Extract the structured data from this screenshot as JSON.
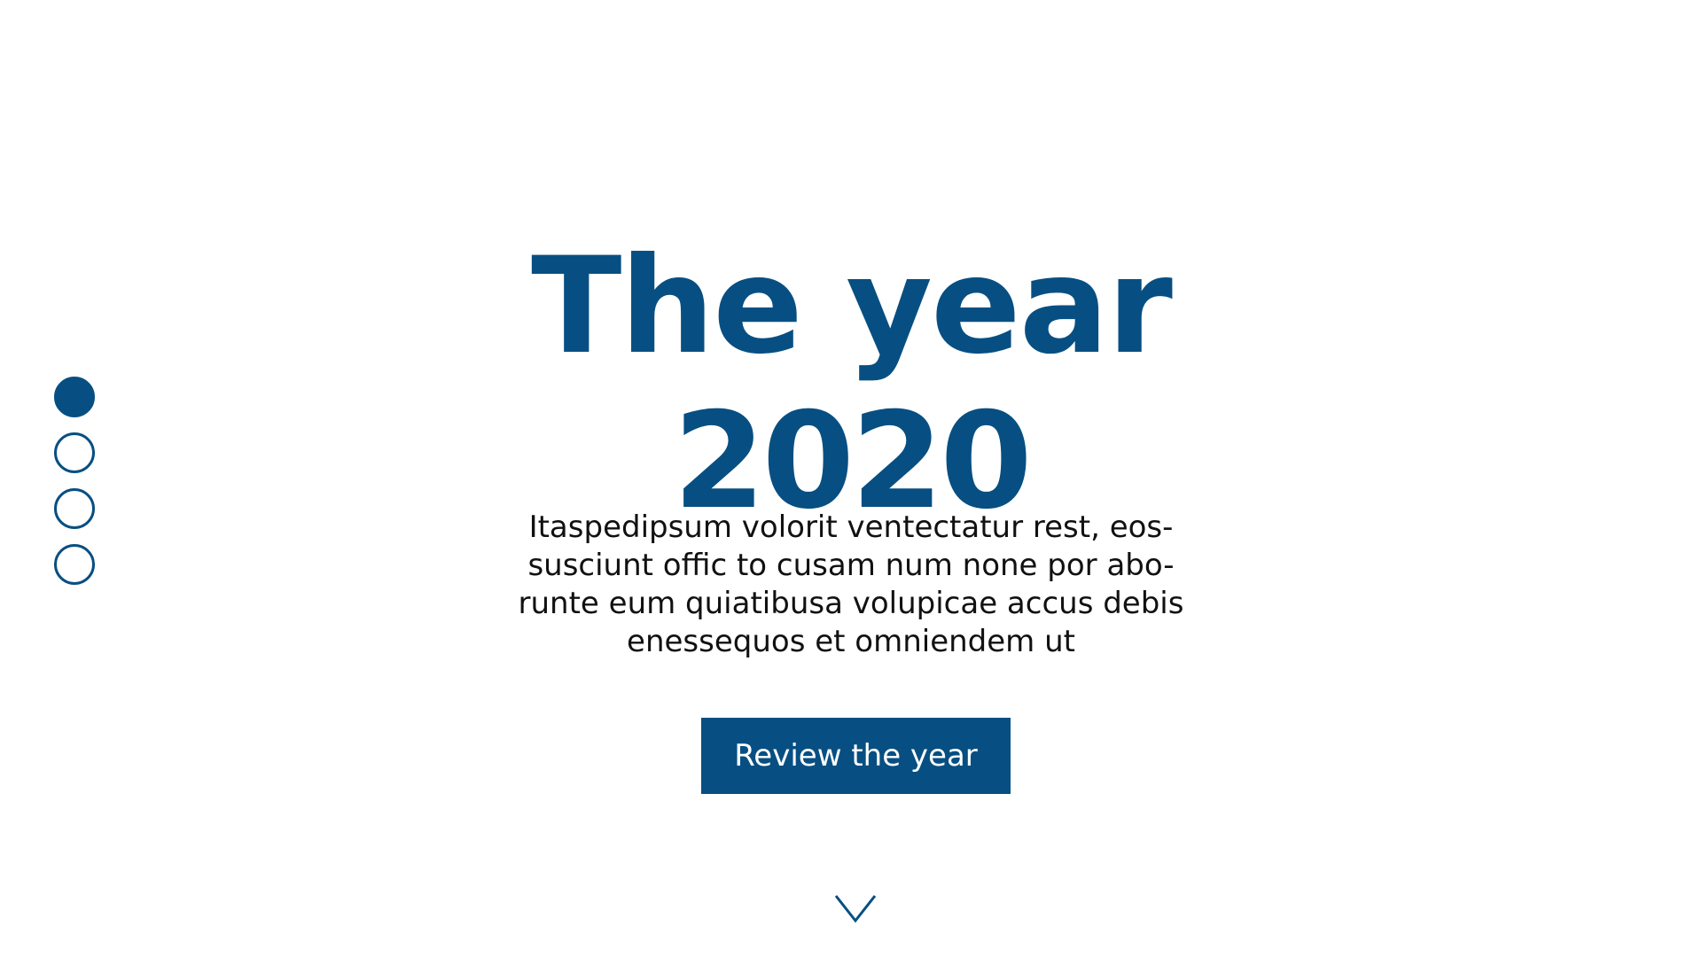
{
  "hero": {
    "title_line1": "The year",
    "title_line2": "2020",
    "description_lines": [
      "Itaspedipsum volorit ventectatur rest, eos-",
      "susciunt offic to cusam num none por abo-",
      "runte eum quiatibusa volupicae accus debis",
      "enessequos et omniendem ut"
    ],
    "cta_label": "Review the year"
  },
  "pager": {
    "count": 4,
    "active_index": 0
  },
  "icons": {
    "scroll": "chevron-down-icon"
  },
  "colors": {
    "accent": "#074f82",
    "text": "#111111",
    "background": "#ffffff",
    "button_text": "#ffffff"
  }
}
